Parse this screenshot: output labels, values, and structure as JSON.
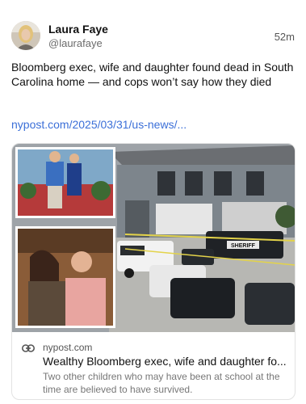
{
  "post": {
    "author_name": "Laura Faye",
    "author_handle": "@laurafaye",
    "timestamp": "52m",
    "text": "Bloomberg exec, wife and daughter found dead in South Carolina home — and cops won’t say how they died",
    "link_text": "nypost.com/2025/03/31/us-news/..."
  },
  "card": {
    "domain": "nypost.com",
    "title": "Wealthy Bloomberg exec, wife and daughter fo...",
    "description": "Two other children who may have been at school at the time are believed to have survived.",
    "image_badge_text": "SHERIFF"
  },
  "colors": {
    "link": "#3b6fd8",
    "muted": "#777777"
  }
}
